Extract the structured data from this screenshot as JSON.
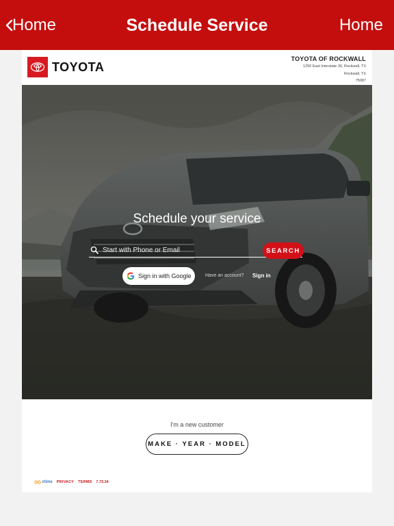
{
  "nav": {
    "back_label": "Home",
    "title": "Schedule Service",
    "right_label": "Home"
  },
  "brand": {
    "wordmark": "TOYOTA",
    "dealer_name": "TOYOTA OF ROCKWALL",
    "address_lines": [
      "1250 East Interstate 30, Rockwall, TX",
      "Rockwall, TX",
      "75087"
    ]
  },
  "hero": {
    "title": "Schedule your service",
    "search_placeholder": "Start with Phone or Email",
    "search_button": "SEARCH",
    "google_label": "Sign in with Google",
    "have_account": "Have an account?",
    "signin_link": "Sign in"
  },
  "new_customer": {
    "label": "I'm a new customer",
    "button": "MAKE · YEAR · MODEL"
  },
  "footer": {
    "brand": "xtime",
    "privacy": "PRIVACY",
    "terms": "TERMS",
    "version": "7.73.34"
  },
  "colors": {
    "nav_red": "#c40e0e",
    "search_red": "#d31018",
    "xtime_blue": "#3e7cc2",
    "xtime_orange": "#f5a623"
  }
}
